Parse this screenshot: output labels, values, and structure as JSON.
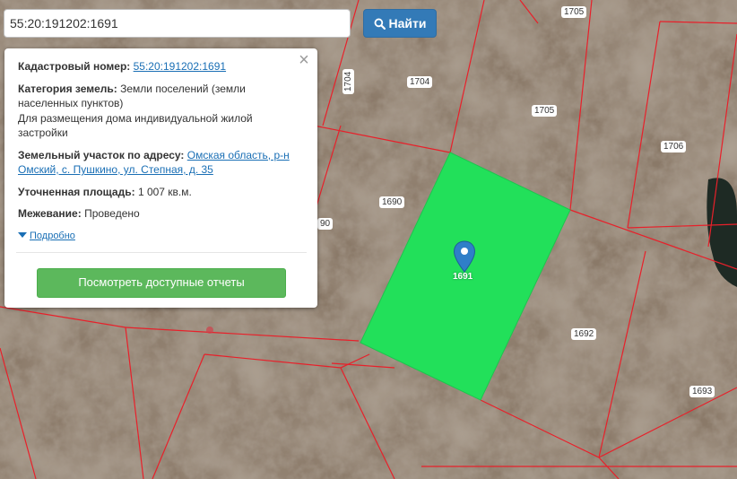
{
  "search": {
    "value": "55:20:191202:1691",
    "button_label": "Найти"
  },
  "popup": {
    "cadastral_label": "Кадастровый номер:",
    "cadastral_value": "55:20:191202:1691",
    "category_label": "Категория земель:",
    "category_value": "Земли поселений (земли населенных пунктов)",
    "usage_value": "Для размещения дома индивидуальной жилой застройки",
    "address_label": "Земельный участок по адресу:",
    "address_value": "Омская область, р-н Омский, с. Пушкино, ул. Степная, д. 35",
    "area_label": "Уточненная площадь:",
    "area_value": "1 007 кв.м.",
    "survey_label": "Межевание:",
    "survey_value": "Проведено",
    "more_link": "Подробно",
    "reports_button": "Посмотреть доступные отчеты"
  },
  "map": {
    "parcel_labels": [
      "1705",
      "1704",
      "1704",
      "1705",
      "1706",
      "1690",
      "90",
      "1692",
      "1693"
    ],
    "selected_parcel_label": "1691",
    "colors": {
      "parcel_border": "#e8202a",
      "selected_parcel_fill": "#22e05a",
      "marker": "#2f7fc8",
      "button_primary": "#337ab7",
      "button_success": "#5cb85c"
    }
  }
}
